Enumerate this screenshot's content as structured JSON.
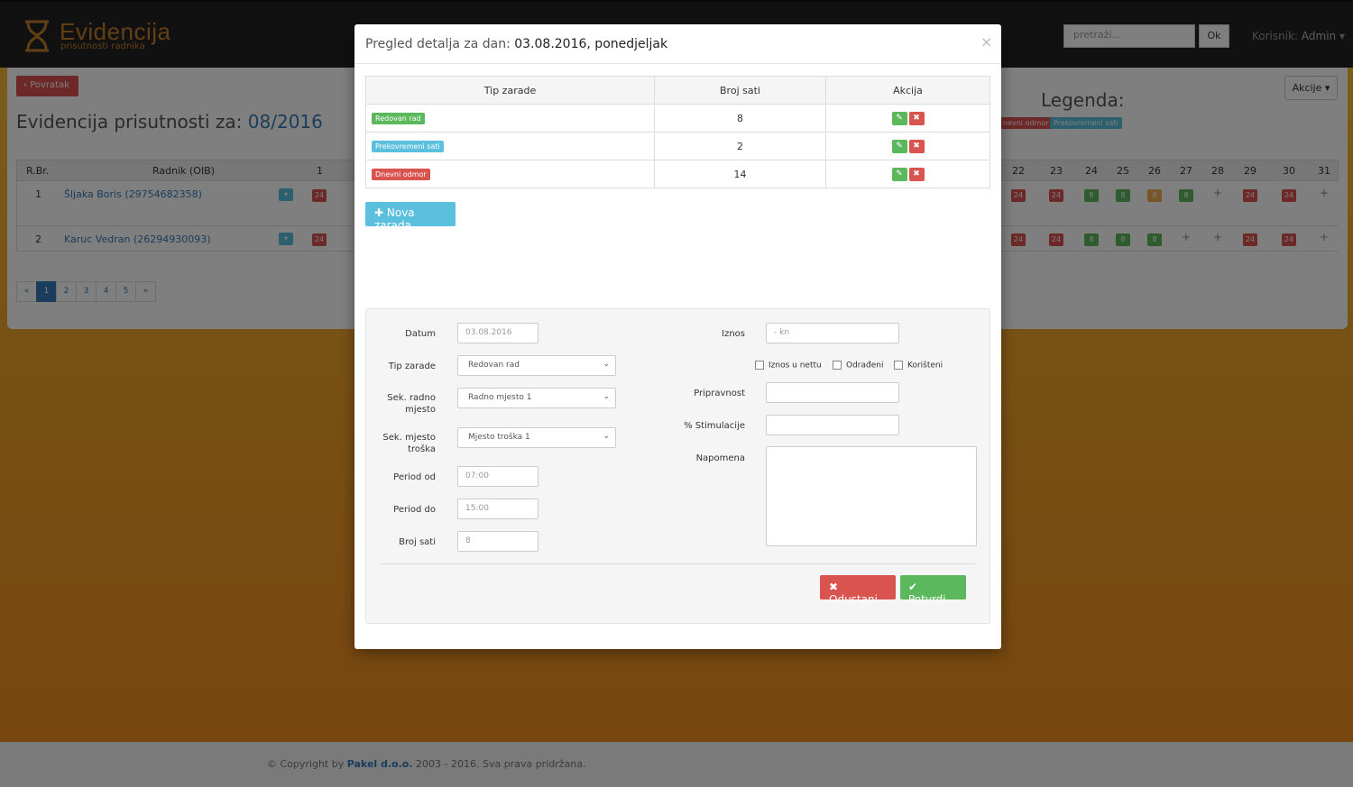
{
  "app": {
    "logo_title": "Evidencija",
    "logo_sub": "prisutnosti radnika",
    "search_placeholder": "pretraži...",
    "ok_label": "Ok",
    "user_label": "Korisnik:",
    "user_name": "Admin"
  },
  "page": {
    "back_label": "Povratak",
    "title_prefix": "Evidencija prisutnosti za:",
    "title_period": "08/2016",
    "legend_title": "Legenda:",
    "legend_items": [
      "nevni odmor",
      "Prekovremeni sati"
    ],
    "actions_label": "Akcije",
    "grid_headers": {
      "rbr": "R.Br.",
      "radnik": "Radnik (OIB)",
      "d1": "1"
    },
    "days": [
      "22",
      "23",
      "24",
      "25",
      "26",
      "27",
      "28",
      "29",
      "30",
      "31"
    ],
    "rows": [
      {
        "rbr": "1",
        "name": "Šljaka Boris (29754682358)",
        "d1": "24",
        "days": [
          "24",
          "24",
          "8",
          "8",
          "8",
          "8",
          "+",
          "24",
          "24",
          "+"
        ]
      },
      {
        "rbr": "2",
        "name": "Karuc Vedran (26294930093)",
        "d1": "24",
        "days": [
          "24",
          "24",
          "8",
          "8",
          "8",
          "+",
          "+",
          "24",
          "24",
          "+"
        ]
      }
    ],
    "pages": [
      "«",
      "1",
      "2",
      "3",
      "4",
      "5",
      "»"
    ]
  },
  "footer": {
    "prefix": "© Copyright by",
    "company": "Pakel d.o.o.",
    "suffix": "2003 - 2016. Sva prava pridržana."
  },
  "modal": {
    "title_prefix": "Pregled detalja za dan:",
    "title_date": "03.08.2016, ponedjeljak",
    "close": "×",
    "table": {
      "headers": [
        "Tip zarade",
        "Broj sati",
        "Akcija"
      ],
      "rows": [
        {
          "tip": "Redovan rad",
          "sati": "8"
        },
        {
          "tip": "Prekovremeni sati",
          "sati": "2"
        },
        {
          "tip": "Dnevni odmor",
          "sati": "14"
        }
      ]
    },
    "new_button": "Nova zarada",
    "form": {
      "datum_label": "Datum",
      "datum_value": "03.08.2016",
      "tip_label": "Tip zarade",
      "tip_value": "Redovan rad",
      "sek_radno_label": "Sek. radno mjesto",
      "sek_radno_value": "Radno mjesto 1",
      "sek_trosak_label": "Sek. mjesto troška",
      "sek_trosak_value": "Mjesto troška 1",
      "period_od_label": "Period od",
      "period_od_value": "07:00",
      "period_do_label": "Period do",
      "period_do_value": "15:00",
      "broj_sati_label": "Broj sati",
      "broj_sati_value": "8",
      "iznos_label": "Iznos",
      "iznos_placeholder": "- kn",
      "chk_netto": "Iznos u nettu",
      "chk_odradeni": "Odrađeni",
      "chk_koristeni": "Korišteni",
      "pripravnost_label": "Pripravnost",
      "stimulacija_label": "% Stimulacije",
      "napomena_label": "Napomena",
      "cancel": "Odustani",
      "confirm": "Potvrdi"
    }
  },
  "colors": {
    "red": "#d9534f",
    "green": "#5cb85c",
    "blue": "#5bc0de",
    "orange": "#f0ad4e",
    "primary": "#337ab7"
  }
}
